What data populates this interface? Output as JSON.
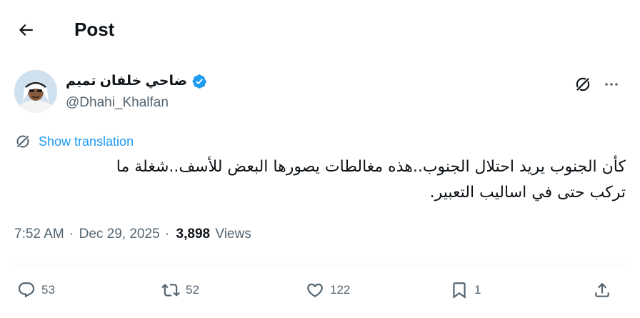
{
  "header": {
    "title": "Post",
    "back_icon": "arrow-left-icon"
  },
  "author": {
    "name": "ضاحي خلفان تميم",
    "handle": "@Dhahi_Khalfan",
    "verified": true,
    "verified_color": "#1d9bf0"
  },
  "translation": {
    "label": "Show translation"
  },
  "tweet": {
    "lines": [
      "كأن الجنوب يريد احتلال الجنوب..هذه مغالطات يصورها البعض للأسف..شغلة ما",
      "تركب حتى في اساليب التعبير."
    ]
  },
  "meta": {
    "time": "7:52 AM",
    "date": "Dec 29, 2025",
    "views_count": "3,898",
    "views_label": "Views",
    "separator": "·"
  },
  "actions": {
    "replies": "53",
    "reposts": "52",
    "likes": "122",
    "bookmarks": "1"
  },
  "colors": {
    "accent": "#1d9bf0",
    "text": "#0f1419",
    "muted": "#536471",
    "divider": "#eff3f4"
  }
}
